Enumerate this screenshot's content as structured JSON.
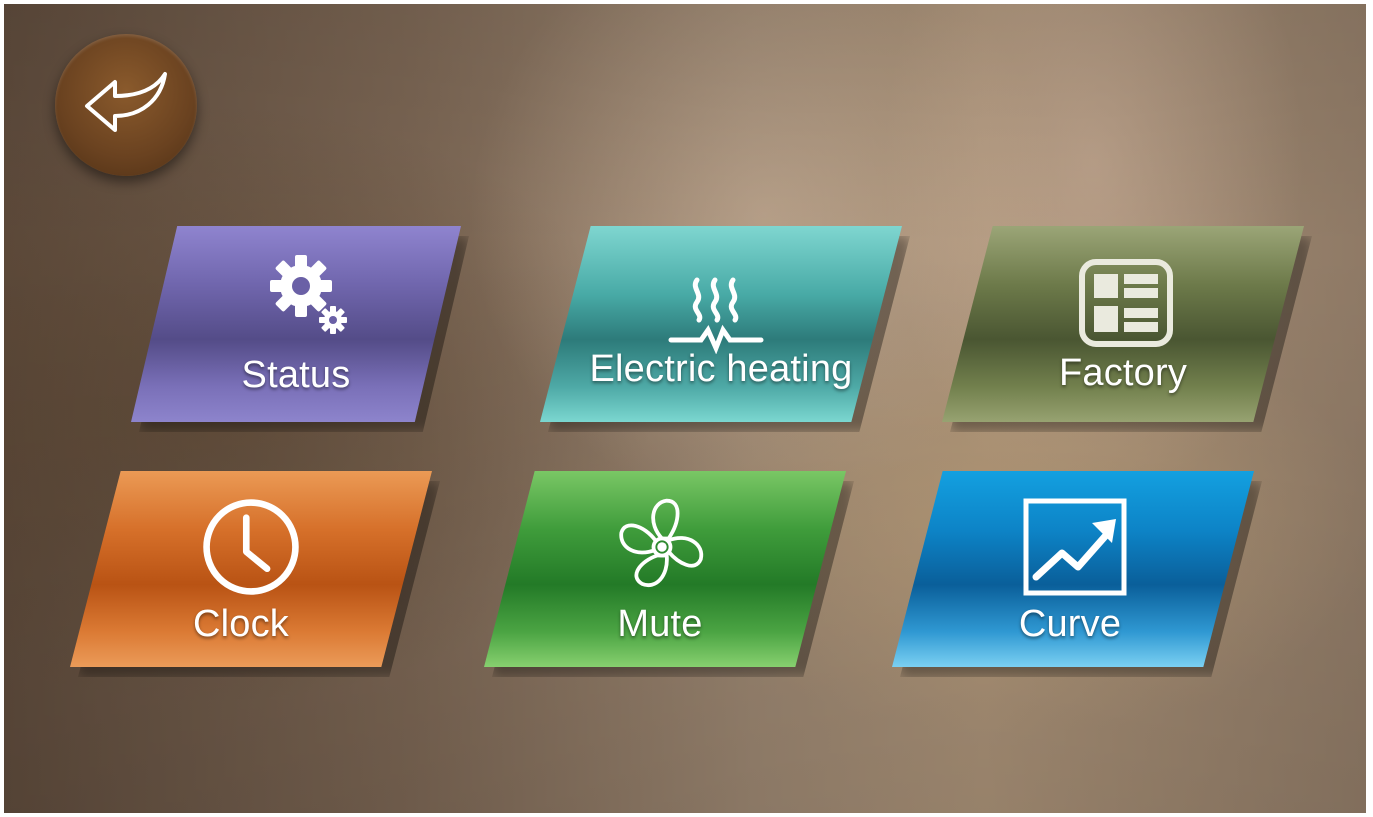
{
  "back_button": {
    "icon": "back-arrow-icon"
  },
  "tiles": [
    {
      "label": "Status",
      "icon": "gears-icon"
    },
    {
      "label": "Electric heating",
      "icon": "heating-icon"
    },
    {
      "label": "Factory",
      "icon": "factory-panel-icon"
    },
    {
      "label": "Clock",
      "icon": "clock-icon"
    },
    {
      "label": "Mute",
      "icon": "fan-icon"
    },
    {
      "label": "Curve",
      "icon": "trend-chart-icon"
    }
  ],
  "colors": {
    "status": "#7066ad",
    "electric_heating": "#48aaa6",
    "factory": "#6d7a4a",
    "clock": "#d6702a",
    "mute": "#3f9c3b",
    "curve": "#0d84c7",
    "back_button": "#6a4220"
  }
}
